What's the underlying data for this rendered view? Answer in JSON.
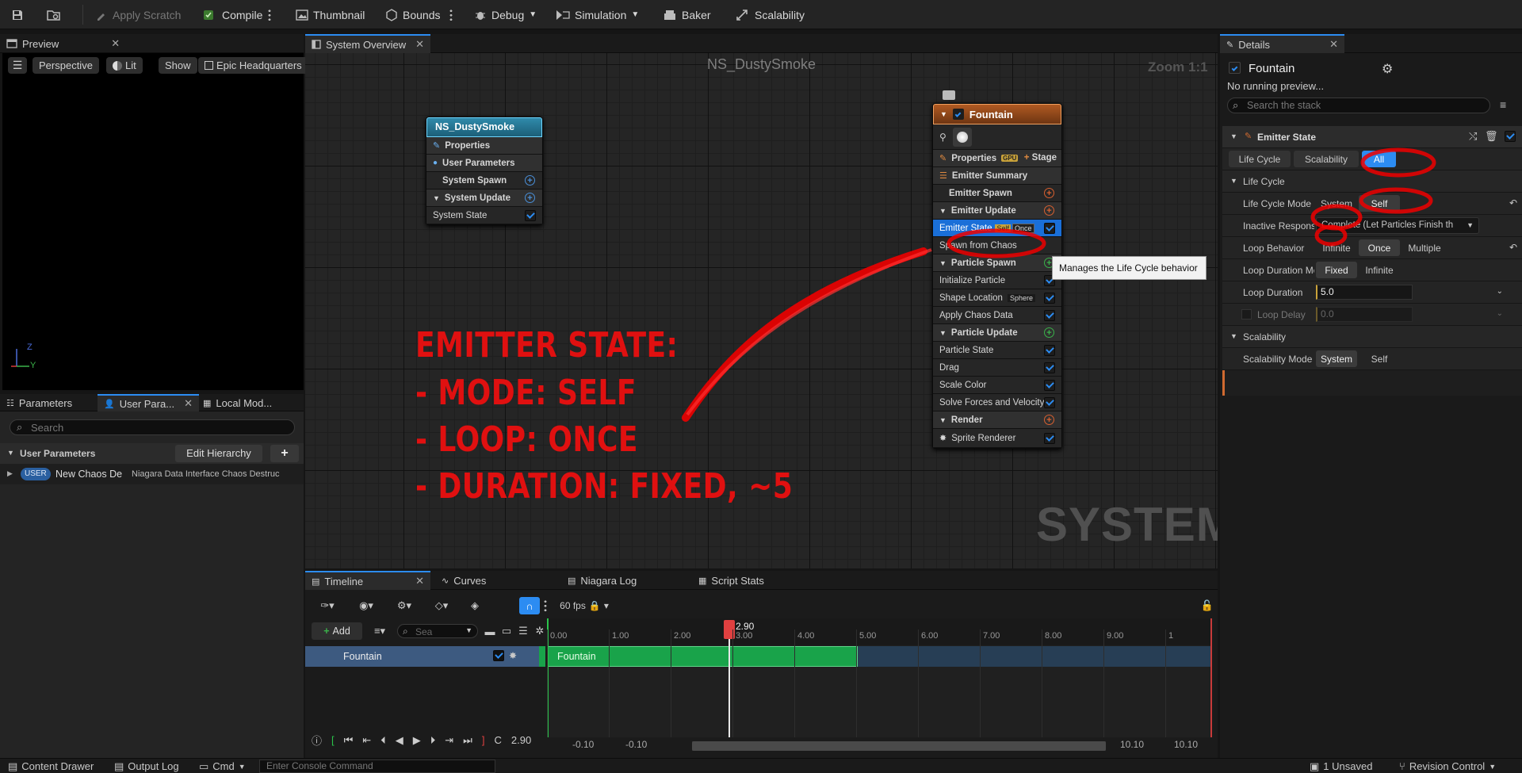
{
  "toolbar": {
    "apply_scratch": "Apply Scratch",
    "compile": "Compile",
    "thumbnail": "Thumbnail",
    "bounds": "Bounds",
    "debug": "Debug",
    "simulation": "Simulation",
    "baker": "Baker",
    "scalability": "Scalability"
  },
  "preview": {
    "tab": "Preview",
    "perspective": "Perspective",
    "lit": "Lit",
    "show": "Show",
    "level": "Epic Headquarters",
    "axis_z": "Z",
    "axis_y": "Y"
  },
  "params": {
    "tabs": [
      "Parameters",
      "User Para...",
      "Local Mod..."
    ],
    "search_placeholder": "Search",
    "section": "User Parameters",
    "edit_hierarchy": "Edit Hierarchy",
    "row_badge": "USER",
    "row_name": "New Chaos De",
    "row_type": "Niagara Data Interface Chaos Destruc"
  },
  "graph": {
    "tab": "System Overview",
    "title": "NS_DustySmoke",
    "zoom": "Zoom 1:1",
    "watermark": "SYSTEM",
    "system_node": {
      "title": "NS_DustySmoke",
      "properties": "Properties",
      "user_params": "User Parameters",
      "system_spawn": "System Spawn",
      "system_update": "System Update",
      "system_state": "System State"
    },
    "emitter_node": {
      "title": "Fountain",
      "properties": "Properties",
      "gpu": "GPU",
      "stage": "Stage",
      "summary": "Emitter Summary",
      "emitter_spawn": "Emitter Spawn",
      "emitter_update": "Emitter Update",
      "emitter_state": "Emitter State",
      "state_self": "Self",
      "state_once": "Once",
      "spawn_from_chaos": "Spawn from Chaos",
      "particle_spawn": "Particle Spawn",
      "init_particle": "Initialize Particle",
      "shape_location": "Shape Location",
      "shape_sphere": "Sphere",
      "apply_chaos": "Apply Chaos Data",
      "particle_update": "Particle Update",
      "particle_state": "Particle State",
      "drag": "Drag",
      "scale_color": "Scale Color",
      "solve_forces": "Solve Forces and Velocity",
      "render": "Render",
      "sprite_renderer": "Sprite Renderer"
    },
    "tooltip": "Manages the Life Cycle behavior",
    "annotation": [
      "EMITTER STATE:",
      "- MODE: SELF",
      "- LOOP: ONCE",
      "- DURATION: FIXED, ~5"
    ]
  },
  "details": {
    "tab": "Details",
    "emitter": "Fountain",
    "no_preview": "No running preview...",
    "search_placeholder": "Search the stack",
    "section": "Emitter State",
    "filter_tabs": [
      "Life Cycle",
      "Scalability",
      "All"
    ],
    "group_lifecycle": "Life Cycle",
    "lifecycle_mode_label": "Life Cycle Mode",
    "lifecycle_mode_options": [
      "System",
      "Self"
    ],
    "inactive_label": "Inactive Respons",
    "inactive_value": "Complete (Let Particles Finish th",
    "loop_behavior_label": "Loop Behavior",
    "loop_behavior_options": [
      "Infinite",
      "Once",
      "Multiple"
    ],
    "loop_duration_mode_label": "Loop Duration Mo",
    "loop_duration_mode_options": [
      "Fixed",
      "Infinite"
    ],
    "loop_duration_label": "Loop Duration",
    "loop_duration_value": "5.0",
    "loop_delay_label": "Loop Delay",
    "loop_delay_value": "0.0",
    "group_scalability": "Scalability",
    "scalability_mode_label": "Scalability Mode",
    "scalability_mode_options": [
      "System",
      "Self"
    ]
  },
  "timeline": {
    "tabs": [
      "Timeline",
      "Curves",
      "Niagara Log",
      "Script Stats"
    ],
    "fps": "60 fps",
    "add": "Add",
    "search_placeholder": "Sea",
    "track": "Fountain",
    "bar_label": "Fountain",
    "ticks": [
      "0.00",
      "1.00",
      "2.00",
      "3.00",
      "4.00",
      "5.00",
      "6.00",
      "7.00",
      "8.00",
      "9.00",
      "1"
    ],
    "playhead": "2.90",
    "current_time": "2.90",
    "range_start_a": "-0.10",
    "range_start_b": "-0.10",
    "range_end_a": "10.10",
    "range_end_b": "10.10",
    "c_label": "C"
  },
  "statusbar": {
    "content_drawer": "Content Drawer",
    "output_log": "Output Log",
    "cmd": "Cmd",
    "console_placeholder": "Enter Console Command",
    "unsaved": "1 Unsaved",
    "revision": "Revision Control"
  },
  "colors": {
    "accent": "#2c8cf2",
    "annotation_red": "#e01010",
    "system_header": "#1f6f8b",
    "emitter_header": "#8a4a1c",
    "timeline_bar": "#19a34a"
  }
}
